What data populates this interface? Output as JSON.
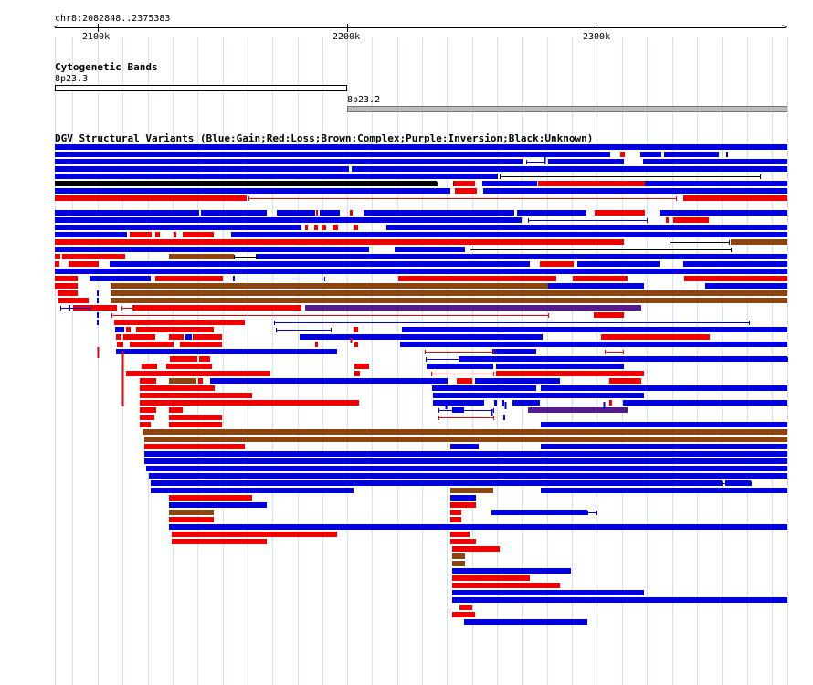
{
  "browser": {
    "locus": "chr8:2082848..2375383",
    "ruler": {
      "ticks": [
        "2100k",
        "2200k",
        "2300k"
      ]
    }
  },
  "cytoband_track": {
    "title": "Cytogenetic Bands",
    "bands": [
      {
        "name": "8p23.3",
        "stain": "white"
      },
      {
        "name": "8p23.2",
        "stain": "gray"
      }
    ]
  },
  "sv_track": {
    "title": "DGV Structural Variants (Blue:Gain;Red:Loss;Brown:Complex;Purple:Inversion;Black:Unknown)",
    "legend_colors": {
      "Gain": "#0000dd",
      "Loss": "#ee0000",
      "Complex": "#8b4513",
      "Inversion": "#551a8b",
      "Unknown": "#000000"
    }
  }
}
